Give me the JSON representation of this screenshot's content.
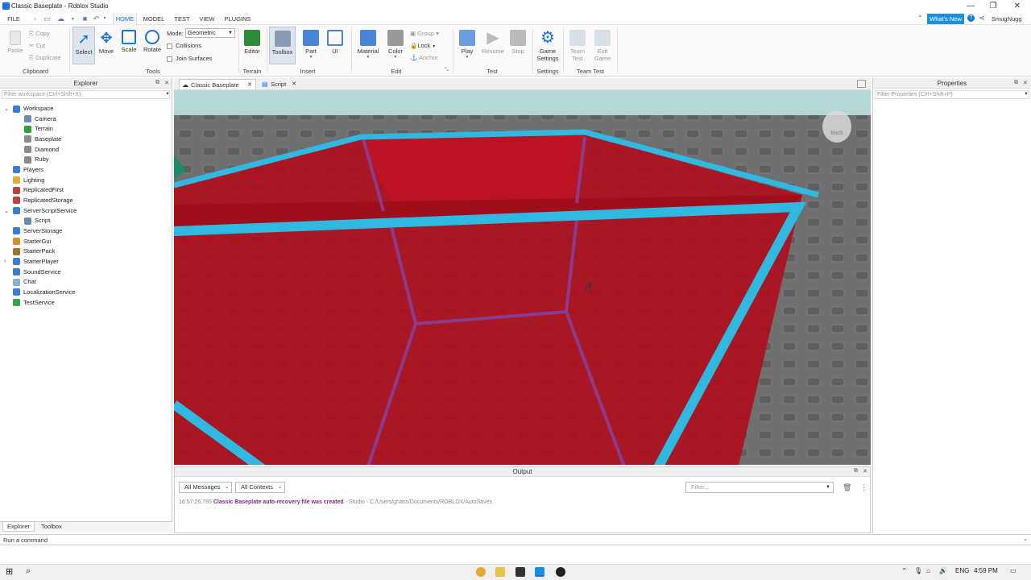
{
  "window": {
    "title": "Classic Baseplate - Roblox Studio",
    "min_glyph": "—",
    "restore_glyph": "❐",
    "close_glyph": "✕"
  },
  "menu": {
    "file": "FILE",
    "tabs": [
      "HOME",
      "MODEL",
      "TEST",
      "VIEW",
      "PLUGINS"
    ],
    "active_tab": "HOME",
    "whats_new": "What's New",
    "username": "SmugNugg"
  },
  "ribbon": {
    "clipboard": {
      "paste": "Paste",
      "copy": "Copy",
      "cut": "Cut",
      "duplicate": "Duplicate",
      "label": "Clipboard"
    },
    "tools": {
      "select": "Select",
      "move": "Move",
      "scale": "Scale",
      "rotate": "Rotate",
      "mode_label": "Mode:",
      "mode_value": "Geometric",
      "collisions": "Collisions",
      "join_surfaces": "Join Surfaces",
      "label": "Tools"
    },
    "terrain": {
      "editor": "Editor",
      "label": "Terrain"
    },
    "insert": {
      "toolbox": "Toolbox",
      "part": "Part",
      "ui": "UI",
      "label": "Insert"
    },
    "edit": {
      "material": "Material",
      "color": "Color",
      "group": "Group",
      "lock": "Lock",
      "anchor": "Anchor",
      "label": "Edit"
    },
    "test": {
      "play": "Play",
      "resume": "Resume",
      "stop": "Stop",
      "label": "Test"
    },
    "settings": {
      "game_settings_1": "Game",
      "game_settings_2": "Settings",
      "label": "Settings"
    },
    "team_test": {
      "team_test_1": "Team",
      "team_test_2": "Test",
      "exit_game_1": "Exit",
      "exit_game_2": "Game",
      "label": "Team Test"
    }
  },
  "explorer": {
    "title": "Explorer",
    "filter_placeholder": "Filter workspace (Ctrl+Shift+X)",
    "items": [
      {
        "label": "Workspace",
        "color": "#3a7bd5"
      },
      {
        "label": "Camera",
        "color": "#6a8caf"
      },
      {
        "label": "Terrain",
        "color": "#2e9e3e"
      },
      {
        "label": "Baseplate",
        "color": "#8a8a8a"
      },
      {
        "label": "Diamond",
        "color": "#8a8a8a"
      },
      {
        "label": "Ruby",
        "color": "#8a8a8a"
      },
      {
        "label": "Players",
        "color": "#3a7bd5"
      },
      {
        "label": "Lighting",
        "color": "#e0b030"
      },
      {
        "label": "ReplicatedFirst",
        "color": "#c04040"
      },
      {
        "label": "ReplicatedStorage",
        "color": "#c04040"
      },
      {
        "label": "ServerScriptService",
        "color": "#3a7bd5"
      },
      {
        "label": "Script",
        "color": "#6a8caf"
      },
      {
        "label": "ServerStorage",
        "color": "#3a7bd5"
      },
      {
        "label": "StarterGui",
        "color": "#d09030"
      },
      {
        "label": "StarterPack",
        "color": "#a07030"
      },
      {
        "label": "StarterPlayer",
        "color": "#3a7bd5"
      },
      {
        "label": "SoundService",
        "color": "#3a7bd5"
      },
      {
        "label": "Chat",
        "color": "#8ab0d0"
      },
      {
        "label": "LocalizationService",
        "color": "#3a7bd5"
      },
      {
        "label": "TestService",
        "color": "#2eaa4a"
      }
    ]
  },
  "doc_tabs": {
    "tab1": "Classic Baseplate",
    "tab2": "Script"
  },
  "viewport": {
    "view_cube_label": "Back"
  },
  "output": {
    "title": "Output",
    "messages_filter": "All Messages",
    "contexts_filter": "All Contexts",
    "filter_placeholder": "Filter...",
    "log": {
      "timestamp": "16:57:26.785",
      "message": "Classic Baseplate auto-recovery file was created",
      "source": "- Studio - C:/Users/ghass/Documents/ROBLOX/AutoSaves"
    }
  },
  "properties": {
    "title": "Properties",
    "filter_placeholder": "Filter Properties (Ctrl+Shift+P)"
  },
  "bottom_tabs": {
    "explorer": "Explorer",
    "toolbox": "Toolbox"
  },
  "command_bar": {
    "placeholder": "Run a command"
  },
  "taskbar": {
    "language": "ENG",
    "time": "4:59 PM"
  },
  "colors": {
    "accent": "#1a73d9",
    "selection_outline": "#2fb8e0",
    "ruby_red": "#b00d1c"
  }
}
